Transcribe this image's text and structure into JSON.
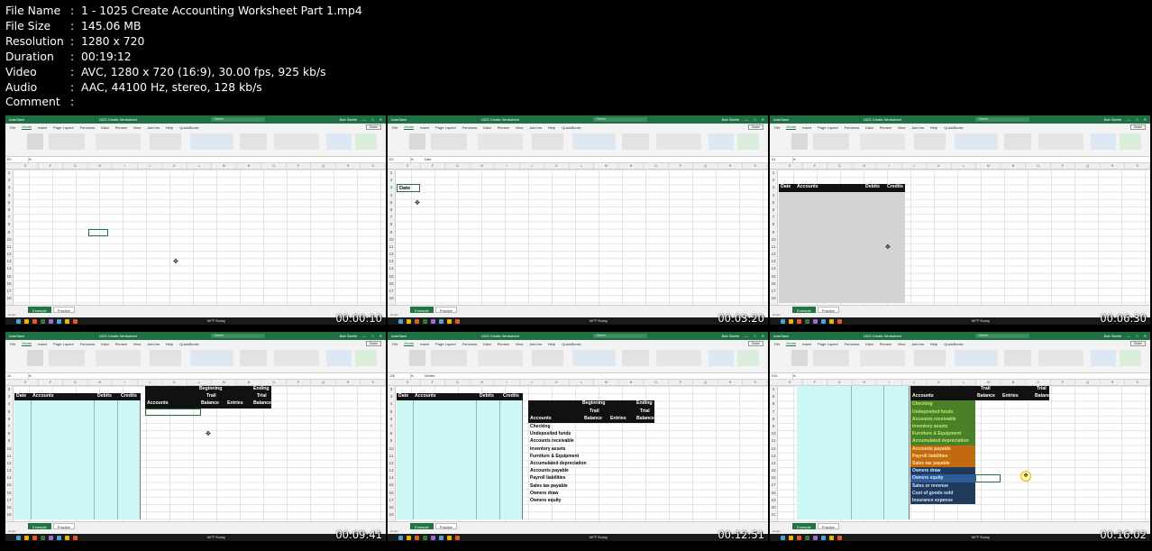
{
  "meta": [
    {
      "key": "File Name",
      "value": "1 - 1025 Create Accounting Worksheet Part 1.mp4"
    },
    {
      "key": "File Size",
      "value": "145.06 MB"
    },
    {
      "key": "Resolution",
      "value": "1280 x 720"
    },
    {
      "key": "Duration",
      "value": "00:19:12"
    },
    {
      "key": "Video",
      "value": "AVC, 1280 x 720 (16:9), 30.00 fps, 925 kb/s"
    },
    {
      "key": "Audio",
      "value": "AAC, 44100 Hz, stereo, 128 kb/s"
    },
    {
      "key": "Comment",
      "value": ""
    }
  ],
  "common": {
    "app": "AutoSave",
    "doc_title": "1025 Create Worksheet",
    "search": "Search",
    "user": "Bob Steele",
    "menu": [
      "File",
      "Home",
      "Insert",
      "Page Layout",
      "Formulas",
      "Data",
      "Review",
      "View",
      "Add-ins",
      "Help",
      "QuickBooks"
    ],
    "share": "Share",
    "sheets": [
      "Example",
      "Practice"
    ],
    "status": "Ready",
    "weather": "60°F  Sunny",
    "cols": [
      "E",
      "F",
      "G",
      "H",
      "I",
      "J",
      "K",
      "L",
      "M",
      "N",
      "O",
      "P",
      "Q",
      "R",
      "S"
    ]
  },
  "thumbs": [
    {
      "time": "00:00:10",
      "namebox": "E9",
      "formula": ""
    },
    {
      "time": "00:03:20",
      "namebox": "E3",
      "formula": "Date",
      "date": "Date"
    },
    {
      "time": "00:06:30",
      "namebox": "E4",
      "formula": "",
      "hdr": [
        "Date",
        "Accounts",
        "Debits",
        "Credits"
      ]
    },
    {
      "time": "00:09:41",
      "namebox": "J4",
      "formula": "",
      "hdr": [
        "Date",
        "Accounts",
        "Debits",
        "Credits"
      ],
      "tb": [
        "Beginning",
        "Trail",
        "Balance",
        "Entries",
        "Ending",
        "Trial",
        "Balance",
        "Accounts"
      ]
    },
    {
      "time": "00:12:51",
      "namebox": "J26",
      "formula": "Utilities",
      "hdr": [
        "Date",
        "Accounts",
        "Debits",
        "Credits"
      ],
      "tb": [
        "Beginning",
        "Trail",
        "Balance",
        "Entries",
        "Ending",
        "Trial",
        "Balance",
        "Accounts"
      ],
      "accounts": [
        "Checking",
        "Undeposited funds",
        "Accounts receivable",
        "Inventory assets",
        "Furniture & Equipment",
        "Accumulated depreciation",
        "Accounts payable",
        "Payroll liabilities",
        "Sales tax payable",
        "Owners draw",
        "Owners equity"
      ]
    },
    {
      "time": "00:16:02",
      "namebox": "K16",
      "formula": "",
      "tb": [
        "Trail",
        "Balance",
        "Entries",
        "Trial",
        "Balance",
        "Accounts"
      ],
      "accounts": [
        "Checking",
        "Undeposited funds",
        "Accounts receivable",
        "Inventory assets",
        "Furniture & Equipment",
        "Accumulated depreciation",
        "Accounts payable",
        "Payroll liabilities",
        "Sales tax payable",
        "Owners draw",
        "Owners equity",
        "Sales or revenue",
        "Cost of goods sold",
        "Insurance expense"
      ]
    }
  ]
}
